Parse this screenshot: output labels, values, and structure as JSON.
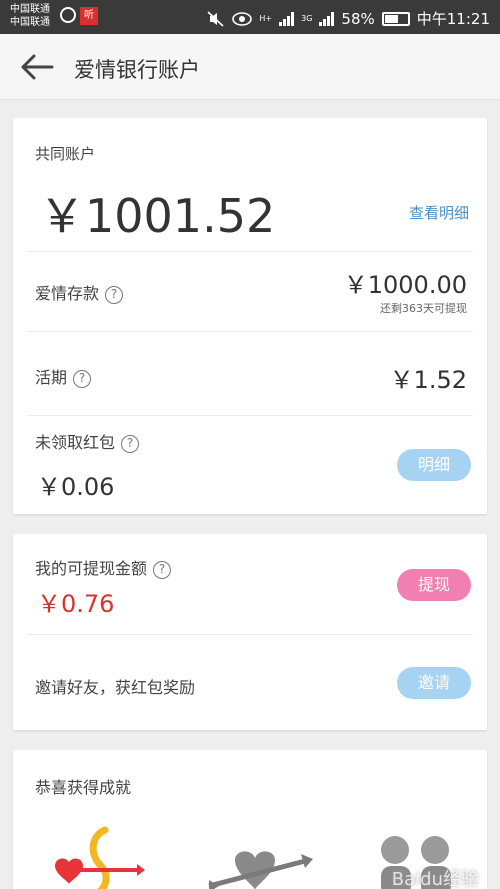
{
  "status_bar": {
    "carrier1": "中国联通",
    "carrier2": "中国联通",
    "app_badge": "听",
    "network1": "H+",
    "network2": "3G",
    "battery": "58%",
    "time": "中午11:21"
  },
  "header": {
    "title": "爱情银行账户"
  },
  "joint_account": {
    "heading": "共同账户",
    "total": "￥1001.52",
    "details_link": "查看明细",
    "love_savings_label": "爱情存款",
    "love_savings_amount": "￥1000.00",
    "love_savings_note": "还剩363天可提现",
    "current_label": "活期",
    "current_amount": "￥1.52",
    "unclaimed_label": "未领取红包",
    "unclaimed_amount": "￥0.06",
    "unclaimed_button": "明细",
    "help_glyph": "?"
  },
  "withdraw": {
    "label": "我的可提现金额",
    "amount": "￥0.76",
    "button": "提现",
    "invite_text": "邀请好友，获红包奖励",
    "invite_button": "邀请"
  },
  "achievements": {
    "heading": "恭喜获得成就",
    "watermark": "Baidu经验"
  },
  "colors": {
    "link": "#4a90c8",
    "pill_blue": "#a7d3f2",
    "pill_pink": "#f27fb1",
    "red_amount": "#d8342c"
  }
}
